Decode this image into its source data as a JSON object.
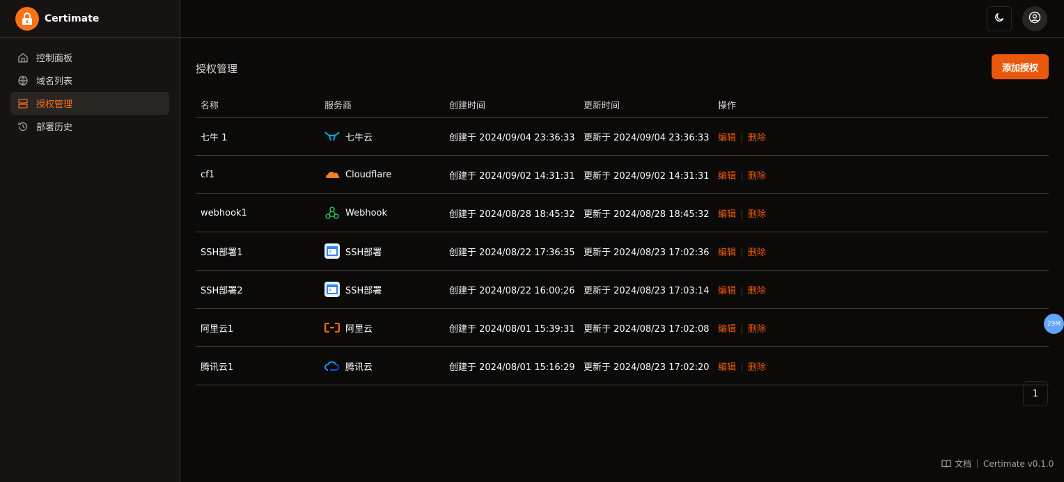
{
  "app": {
    "name": "Certimate",
    "version_label": "Certimate v0.1.0",
    "docs_label": "文档",
    "accent_color": "#f97316"
  },
  "sidebar": {
    "items": [
      {
        "label": "控制面板",
        "icon": "home-icon",
        "active": false
      },
      {
        "label": "域名列表",
        "icon": "globe-icon",
        "active": false
      },
      {
        "label": "授权管理",
        "icon": "server-icon",
        "active": true
      },
      {
        "label": "部署历史",
        "icon": "history-icon",
        "active": false
      }
    ]
  },
  "page": {
    "title": "授权管理",
    "add_button": "添加授权"
  },
  "table": {
    "headers": [
      "名称",
      "服务商",
      "创建时间",
      "更新时间",
      "操作"
    ],
    "rows": [
      {
        "name": "七牛 1",
        "provider": "七牛云",
        "provider_icon": "qiniu-icon",
        "created": "创建于 2024/09/04 23:36:33",
        "updated": "更新于 2024/09/04 23:36:33"
      },
      {
        "name": "cf1",
        "provider": "Cloudflare",
        "provider_icon": "cloudflare-icon",
        "created": "创建于 2024/09/02 14:31:31",
        "updated": "更新于 2024/09/02 14:31:31"
      },
      {
        "name": "webhook1",
        "provider": "Webhook",
        "provider_icon": "webhook-icon",
        "created": "创建于 2024/08/28 18:45:32",
        "updated": "更新于 2024/08/28 18:45:32"
      },
      {
        "name": "SSH部署1",
        "provider": "SSH部署",
        "provider_icon": "ssh-icon",
        "created": "创建于 2024/08/22 17:36:35",
        "updated": "更新于 2024/08/23 17:02:36"
      },
      {
        "name": "SSH部署2",
        "provider": "SSH部署",
        "provider_icon": "ssh-icon",
        "created": "创建于 2024/08/22 16:00:26",
        "updated": "更新于 2024/08/23 17:03:14"
      },
      {
        "name": "阿里云1",
        "provider": "阿里云",
        "provider_icon": "aliyun-icon",
        "created": "创建于 2024/08/01 15:39:31",
        "updated": "更新于 2024/08/23 17:02:08"
      },
      {
        "name": "腾讯云1",
        "provider": "腾讯云",
        "provider_icon": "tencent-cloud-icon",
        "created": "创建于 2024/08/01 15:16:29",
        "updated": "更新于 2024/08/23 17:02:20"
      }
    ],
    "edit_label": "编辑",
    "delete_label": "删除"
  },
  "pagination": {
    "current_page": "1"
  },
  "floating_badge": "29M"
}
